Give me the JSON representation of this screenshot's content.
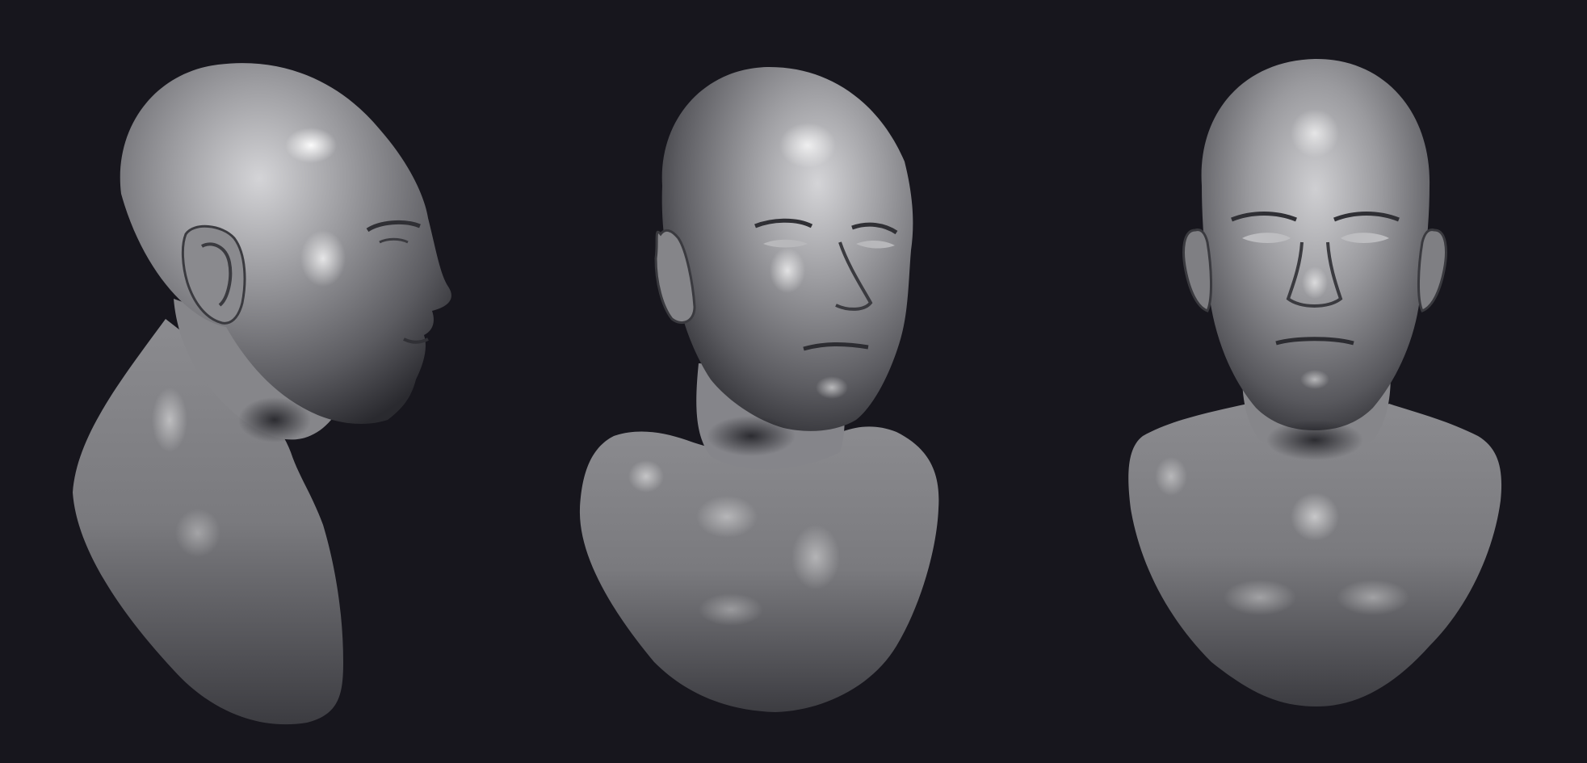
{
  "scene": {
    "background": "#17161d",
    "material": "#8e8e90",
    "material_highlight": "#e4e4e6",
    "material_shadow": "#2a2a2f",
    "views": [
      {
        "name": "side-view",
        "facing": "right"
      },
      {
        "name": "three-quarter-view",
        "facing": "three-quarter-right"
      },
      {
        "name": "front-view",
        "facing": "front"
      }
    ]
  }
}
